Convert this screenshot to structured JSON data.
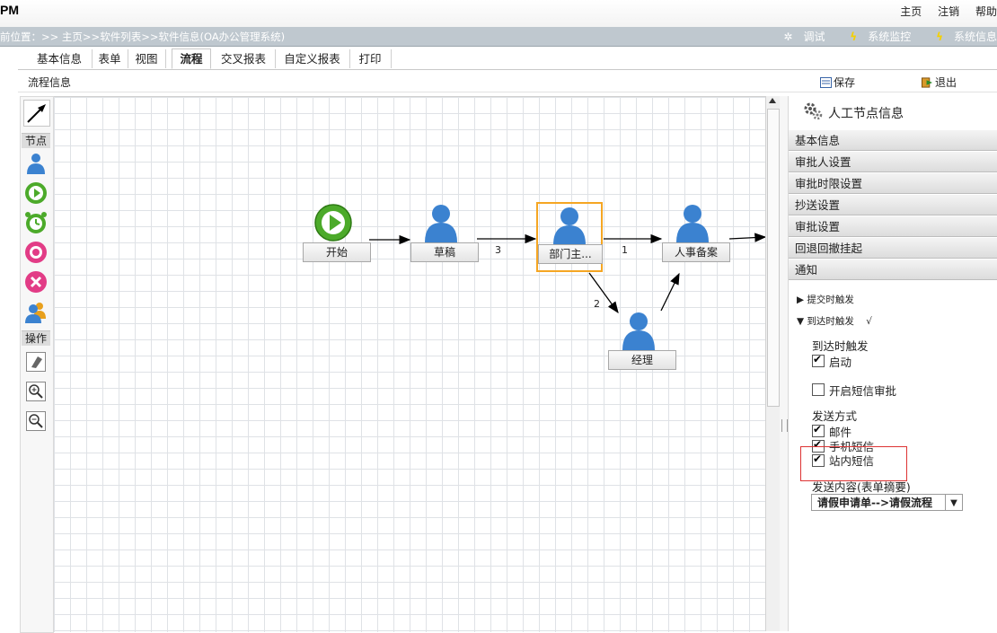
{
  "top": {
    "logo": "PM",
    "links": [
      "主页",
      "注销",
      "帮助"
    ]
  },
  "breadcrumb": {
    "text": "前位置：>> 主页>>软件列表>>软件信息(OA办公管理系统)",
    "tools": [
      "调试",
      "系统监控",
      "系统信息"
    ]
  },
  "tabs": [
    "基本信息",
    "表单",
    "视图",
    "流程",
    "交叉报表",
    "自定义报表",
    "打印"
  ],
  "active_tab": "流程",
  "titlebar": {
    "title": "流程信息",
    "save": "保存",
    "exit": "退出"
  },
  "toolbox": {
    "nodes_label": "节点",
    "ops_label": "操作"
  },
  "flow": {
    "nodes": {
      "start": "开始",
      "draft": "草稿",
      "dept": "部门主...",
      "hr": "人事备案",
      "manager": "经理"
    },
    "edge_labels": {
      "draft_dept": "3",
      "dept_hr": "1",
      "dept_manager": "2"
    }
  },
  "panel": {
    "title": "人工节点信息",
    "sections": [
      "基本信息",
      "审批人设置",
      "审批时限设置",
      "抄送设置",
      "审批设置",
      "回退回撤挂起",
      "通知"
    ],
    "submit_trigger": "提交时触发",
    "arrive_trigger": "到达时触发",
    "arrive_mark": "√",
    "arrive_title": "到达时触发",
    "enable": "启动",
    "sms_approve": "开启短信审批",
    "send_mode": "发送方式",
    "methods": [
      "邮件",
      "手机短信",
      "站内短信"
    ],
    "content_label": "发送内容(表单摘要)",
    "content_value": "请假申请单-->请假流程"
  }
}
